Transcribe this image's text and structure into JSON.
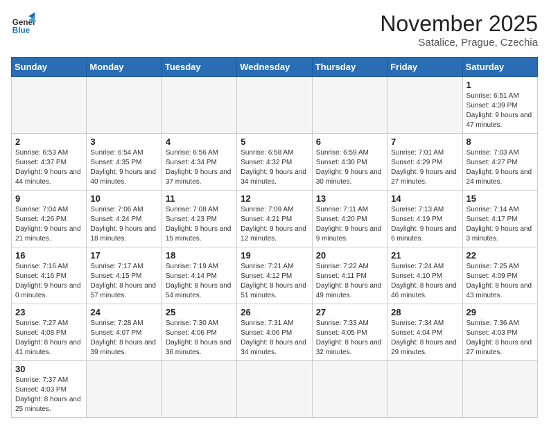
{
  "header": {
    "logo_general": "General",
    "logo_blue": "Blue",
    "month_title": "November 2025",
    "subtitle": "Satalice, Prague, Czechia"
  },
  "days_of_week": [
    "Sunday",
    "Monday",
    "Tuesday",
    "Wednesday",
    "Thursday",
    "Friday",
    "Saturday"
  ],
  "weeks": [
    {
      "cells": [
        {
          "day": null,
          "empty": true
        },
        {
          "day": null,
          "empty": true
        },
        {
          "day": null,
          "empty": true
        },
        {
          "day": null,
          "empty": true
        },
        {
          "day": null,
          "empty": true
        },
        {
          "day": null,
          "empty": true
        },
        {
          "day": 1,
          "sunrise": "6:51 AM",
          "sunset": "4:39 PM",
          "daylight": "9 hours and 47 minutes."
        }
      ]
    },
    {
      "cells": [
        {
          "day": 2,
          "sunrise": "6:53 AM",
          "sunset": "4:37 PM",
          "daylight": "9 hours and 44 minutes."
        },
        {
          "day": 3,
          "sunrise": "6:54 AM",
          "sunset": "4:35 PM",
          "daylight": "9 hours and 40 minutes."
        },
        {
          "day": 4,
          "sunrise": "6:56 AM",
          "sunset": "4:34 PM",
          "daylight": "9 hours and 37 minutes."
        },
        {
          "day": 5,
          "sunrise": "6:58 AM",
          "sunset": "4:32 PM",
          "daylight": "9 hours and 34 minutes."
        },
        {
          "day": 6,
          "sunrise": "6:59 AM",
          "sunset": "4:30 PM",
          "daylight": "9 hours and 30 minutes."
        },
        {
          "day": 7,
          "sunrise": "7:01 AM",
          "sunset": "4:29 PM",
          "daylight": "9 hours and 27 minutes."
        },
        {
          "day": 8,
          "sunrise": "7:03 AM",
          "sunset": "4:27 PM",
          "daylight": "9 hours and 24 minutes."
        }
      ]
    },
    {
      "cells": [
        {
          "day": 9,
          "sunrise": "7:04 AM",
          "sunset": "4:26 PM",
          "daylight": "9 hours and 21 minutes."
        },
        {
          "day": 10,
          "sunrise": "7:06 AM",
          "sunset": "4:24 PM",
          "daylight": "9 hours and 18 minutes."
        },
        {
          "day": 11,
          "sunrise": "7:08 AM",
          "sunset": "4:23 PM",
          "daylight": "9 hours and 15 minutes."
        },
        {
          "day": 12,
          "sunrise": "7:09 AM",
          "sunset": "4:21 PM",
          "daylight": "9 hours and 12 minutes."
        },
        {
          "day": 13,
          "sunrise": "7:11 AM",
          "sunset": "4:20 PM",
          "daylight": "9 hours and 9 minutes."
        },
        {
          "day": 14,
          "sunrise": "7:13 AM",
          "sunset": "4:19 PM",
          "daylight": "9 hours and 6 minutes."
        },
        {
          "day": 15,
          "sunrise": "7:14 AM",
          "sunset": "4:17 PM",
          "daylight": "9 hours and 3 minutes."
        }
      ]
    },
    {
      "cells": [
        {
          "day": 16,
          "sunrise": "7:16 AM",
          "sunset": "4:16 PM",
          "daylight": "9 hours and 0 minutes."
        },
        {
          "day": 17,
          "sunrise": "7:17 AM",
          "sunset": "4:15 PM",
          "daylight": "8 hours and 57 minutes."
        },
        {
          "day": 18,
          "sunrise": "7:19 AM",
          "sunset": "4:14 PM",
          "daylight": "8 hours and 54 minutes."
        },
        {
          "day": 19,
          "sunrise": "7:21 AM",
          "sunset": "4:12 PM",
          "daylight": "8 hours and 51 minutes."
        },
        {
          "day": 20,
          "sunrise": "7:22 AM",
          "sunset": "4:11 PM",
          "daylight": "8 hours and 49 minutes."
        },
        {
          "day": 21,
          "sunrise": "7:24 AM",
          "sunset": "4:10 PM",
          "daylight": "8 hours and 46 minutes."
        },
        {
          "day": 22,
          "sunrise": "7:25 AM",
          "sunset": "4:09 PM",
          "daylight": "8 hours and 43 minutes."
        }
      ]
    },
    {
      "cells": [
        {
          "day": 23,
          "sunrise": "7:27 AM",
          "sunset": "4:08 PM",
          "daylight": "8 hours and 41 minutes."
        },
        {
          "day": 24,
          "sunrise": "7:28 AM",
          "sunset": "4:07 PM",
          "daylight": "8 hours and 39 minutes."
        },
        {
          "day": 25,
          "sunrise": "7:30 AM",
          "sunset": "4:06 PM",
          "daylight": "8 hours and 36 minutes."
        },
        {
          "day": 26,
          "sunrise": "7:31 AM",
          "sunset": "4:06 PM",
          "daylight": "8 hours and 34 minutes."
        },
        {
          "day": 27,
          "sunrise": "7:33 AM",
          "sunset": "4:05 PM",
          "daylight": "8 hours and 32 minutes."
        },
        {
          "day": 28,
          "sunrise": "7:34 AM",
          "sunset": "4:04 PM",
          "daylight": "8 hours and 29 minutes."
        },
        {
          "day": 29,
          "sunrise": "7:36 AM",
          "sunset": "4:03 PM",
          "daylight": "8 hours and 27 minutes."
        }
      ]
    },
    {
      "cells": [
        {
          "day": 30,
          "sunrise": "7:37 AM",
          "sunset": "4:03 PM",
          "daylight": "8 hours and 25 minutes."
        },
        {
          "day": null,
          "empty": true
        },
        {
          "day": null,
          "empty": true
        },
        {
          "day": null,
          "empty": true
        },
        {
          "day": null,
          "empty": true
        },
        {
          "day": null,
          "empty": true
        },
        {
          "day": null,
          "empty": true
        }
      ]
    }
  ]
}
